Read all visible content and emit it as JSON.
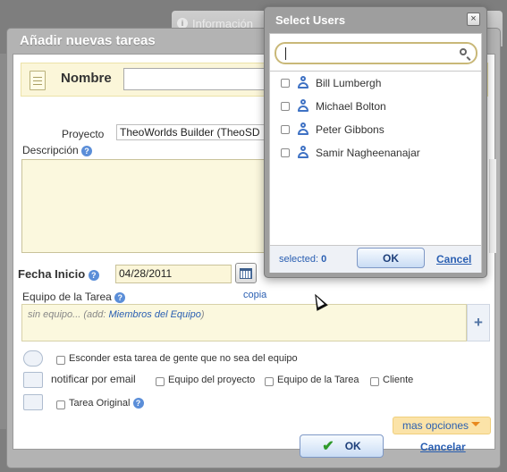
{
  "background": {
    "tab_label": "Información",
    "info_icon": "i"
  },
  "dialog": {
    "title": "Añadir nuevas tareas",
    "name_label": "Nombre",
    "name_value": "",
    "project_label": "Proyecto",
    "project_value": "TheoWorlds Builder (TheoSD",
    "description_label": "Descripción",
    "description_value": "",
    "start_date_label": "Fecha Inicio",
    "start_date_value": "04/28/2011",
    "team_label": "Equipo de la Tarea",
    "copy_link": "copia",
    "team_empty_prefix": "sin equipo... (add: ",
    "team_members_link": "Miembros del Equipo",
    "team_empty_suffix": ")",
    "team_add_symbol": "+",
    "hide_task_label": "Esconder esta tarea de gente que no sea del equipo",
    "notify_label": "notificar por email",
    "notify_options": [
      "Equipo del proyecto",
      "Equipo de la Tarea",
      "Cliente"
    ],
    "original_task_label": "Tarea Original",
    "more_options": "mas opciones",
    "ok_label": "OK",
    "cancel_label": "Cancelar",
    "help_glyph": "?"
  },
  "select_users": {
    "title": "Select Users",
    "close_glyph": "×",
    "search_value": "",
    "users": [
      {
        "name": "Bill Lumbergh",
        "checked": false
      },
      {
        "name": "Michael Bolton",
        "checked": false
      },
      {
        "name": "Peter Gibbons",
        "checked": false
      },
      {
        "name": "Samir Nagheenanajar",
        "checked": false
      }
    ],
    "selected_label": "selected:",
    "selected_count": "0",
    "ok_label": "OK",
    "cancel_label": "Cancel"
  },
  "colors": {
    "link": "#2a5fb2",
    "field_background": "#fbf8de",
    "more_options_background": "#fbe3a8"
  }
}
